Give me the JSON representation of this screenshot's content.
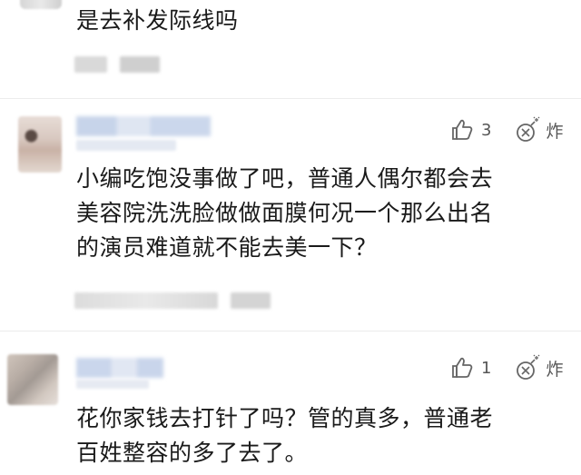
{
  "comments": [
    {
      "text_lines": [
        "是去补发际线吗"
      ]
    },
    {
      "like_count": "3",
      "report_label": "炸",
      "text_lines": [
        "小编吃饱没事做了吧，普通人偶尔都会去",
        "美容院洗洗脸做做面膜何况一个那么出名",
        "的演员难道就不能去美一下？"
      ]
    },
    {
      "like_count": "1",
      "report_label": "炸",
      "text_lines": [
        "花你家钱去打针了吗？管的真多，普通老",
        "百姓整容的多了去了。"
      ]
    }
  ],
  "icons": {
    "like": "thumbs-up-icon",
    "report": "bomb-icon"
  },
  "colors": {
    "background": "#ffffff",
    "text": "#1a1a1a",
    "meta_blur": "#cfd6e4",
    "icon": "#666666"
  }
}
